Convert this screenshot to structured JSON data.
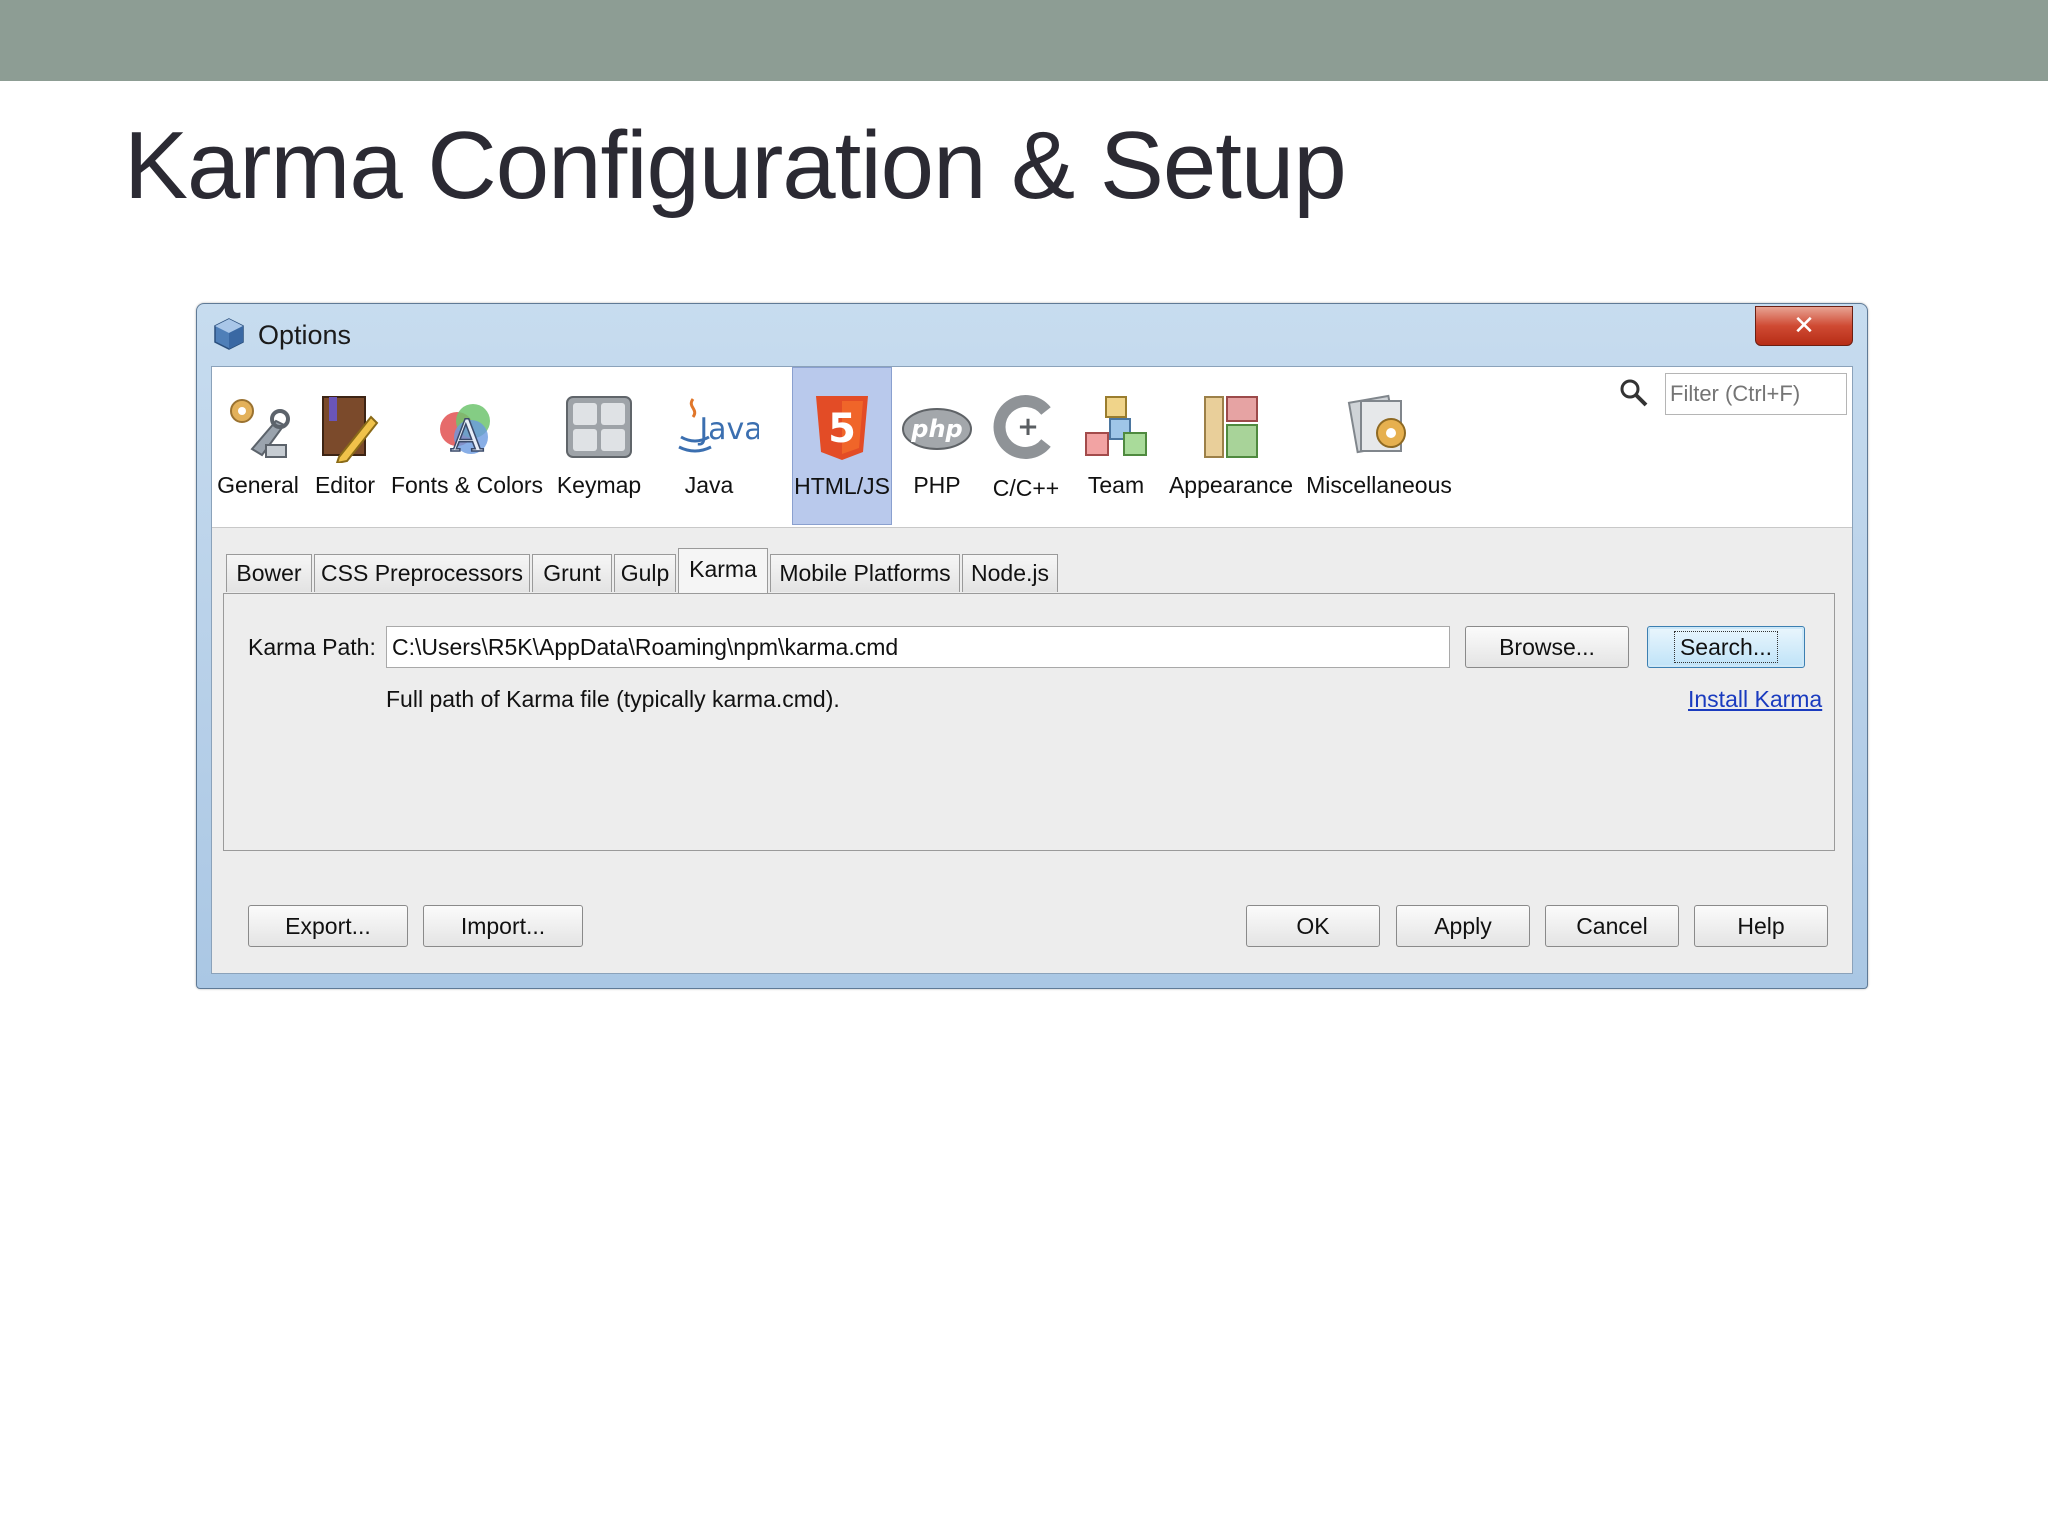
{
  "slide": {
    "title": "Karma Configuration & Setup"
  },
  "window": {
    "title": "Options",
    "close_icon": "close-icon"
  },
  "toolbar": {
    "categories": [
      {
        "label": "General",
        "icon": "general-wrench-gear-icon"
      },
      {
        "label": "Editor",
        "icon": "editor-book-pencil-icon"
      },
      {
        "label": "Fonts & Colors",
        "icon": "fonts-colors-icon"
      },
      {
        "label": "Keymap",
        "icon": "keymap-keyboard-icon"
      },
      {
        "label": "Java",
        "icon": "java-cup-icon",
        "icon_text": "Java"
      },
      {
        "label": "HTML/JS",
        "icon": "html5-shield-icon",
        "icon_text": "5",
        "selected": true
      },
      {
        "label": "PHP",
        "icon": "php-logo-icon",
        "icon_text": "php"
      },
      {
        "label": "C/C++",
        "icon": "cpp-logo-icon"
      },
      {
        "label": "Team",
        "icon": "team-cubes-icon"
      },
      {
        "label": "Appearance",
        "icon": "appearance-layout-icon"
      },
      {
        "label": "Miscellaneous",
        "icon": "miscellaneous-gear-icon"
      }
    ],
    "filter_placeholder": "Filter (Ctrl+F)"
  },
  "tabs": [
    {
      "label": "Bower"
    },
    {
      "label": "CSS Preprocessors"
    },
    {
      "label": "Grunt"
    },
    {
      "label": "Gulp"
    },
    {
      "label": "Karma",
      "active": true
    },
    {
      "label": "Mobile Platforms"
    },
    {
      "label": "Node.js"
    }
  ],
  "karma": {
    "path_label": "Karma Path:",
    "path_value": "C:\\Users\\R5K\\AppData\\Roaming\\npm\\karma.cmd",
    "hint": "Full path of Karma file (typically karma.cmd).",
    "browse_label": "Browse...",
    "search_label": "Search...",
    "install_link": "Install Karma"
  },
  "footer": {
    "export_label": "Export...",
    "import_label": "Import...",
    "ok_label": "OK",
    "apply_label": "Apply",
    "cancel_label": "Cancel",
    "help_label": "Help"
  },
  "colors": {
    "top_band": "#8d9d94",
    "selected_category": "#b9c9ec",
    "link": "#1a3bbf",
    "close_button": "#cf4a33"
  }
}
